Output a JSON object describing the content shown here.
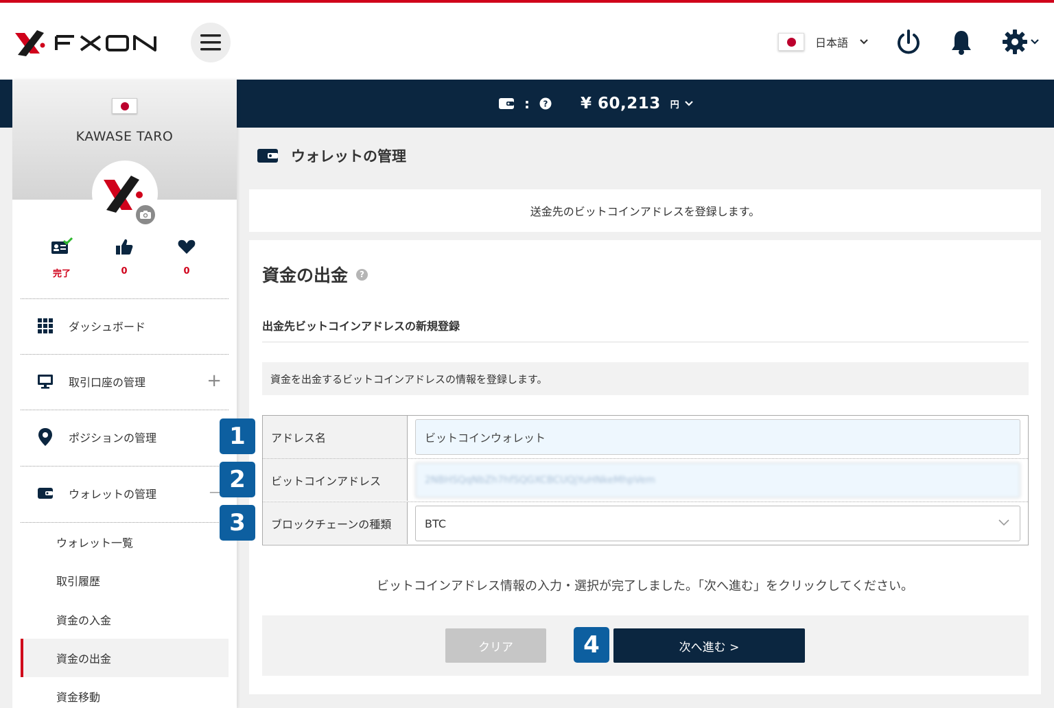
{
  "header": {
    "logo_text": "FXON",
    "language": "日本語"
  },
  "balance": {
    "separator": ":",
    "amount": "¥ 60,213",
    "unit": "円"
  },
  "profile": {
    "name": "KAWASE TARO",
    "stats": [
      {
        "label": "完了"
      },
      {
        "label": "0"
      },
      {
        "label": "0"
      }
    ]
  },
  "sidebar": {
    "items": [
      {
        "label": "ダッシュボード"
      },
      {
        "label": "取引口座の管理"
      },
      {
        "label": "ポジションの管理"
      },
      {
        "label": "ウォレットの管理"
      }
    ],
    "plus": "+",
    "minus": "—",
    "subitems": [
      {
        "label": "ウォレット一覧"
      },
      {
        "label": "取引履歴"
      },
      {
        "label": "資金の入金"
      },
      {
        "label": "資金の出金"
      },
      {
        "label": "資金移動"
      }
    ]
  },
  "page": {
    "title": "ウォレットの管理",
    "notice": "送金先のビットコインアドレスを登録します。",
    "panel_title": "資金の出金",
    "help": "?",
    "section_title": "出金先ビットコインアドレスの新規登録",
    "info": "資金を出金するビットコインアドレスの情報を登録します。"
  },
  "form": {
    "address_name_label": "アドレス名",
    "address_name_value": "ビットコインウォレット",
    "btc_address_label": "ビットコインアドレス",
    "btc_address_value": "2NBHSQqNbZh7hfSQGXCBCUQjYuHNkeMhpVem",
    "chain_label": "ブロックチェーンの種類",
    "chain_value": "BTC"
  },
  "badges": [
    "1",
    "2",
    "3",
    "4"
  ],
  "complete_message": "ビットコインアドレス情報の入力・選択が完了しました。「次へ進む」をクリックしてください。",
  "buttons": {
    "clear": "クリア",
    "next": "次へ進む >"
  },
  "colors": {
    "accent_red": "#d0021b",
    "navy": "#0b2640",
    "badge_blue": "#0d5fa0",
    "input_bg": "#eef7fe"
  }
}
